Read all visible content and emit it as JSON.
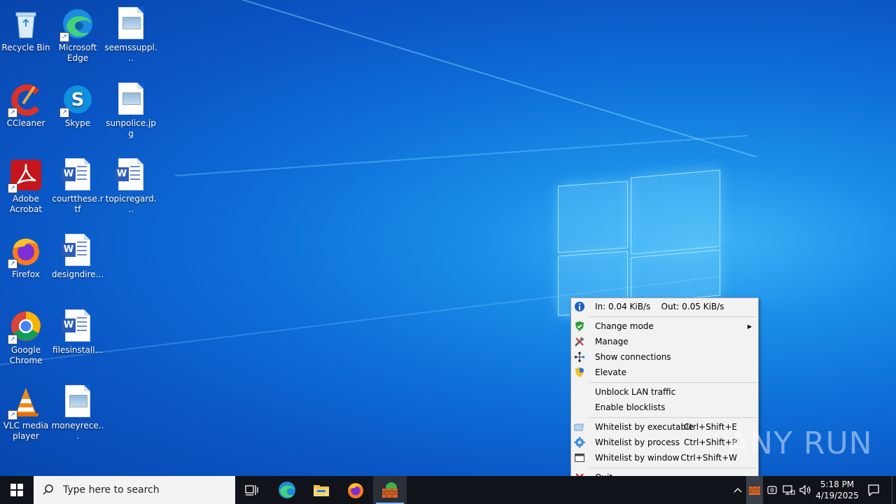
{
  "desktop": {
    "icons": [
      {
        "label": "Recycle Bin"
      },
      {
        "label": "Microsoft Edge"
      },
      {
        "label": "seemssuppl..."
      },
      {
        "label": "CCleaner"
      },
      {
        "label": "Skype"
      },
      {
        "label": "sunpolice.jpg"
      },
      {
        "label": "Adobe Acrobat"
      },
      {
        "label": "courtthese.rtf"
      },
      {
        "label": "topicregard..."
      },
      {
        "label": "Firefox"
      },
      {
        "label": "designdire..."
      },
      {
        "label": "Google Chrome"
      },
      {
        "label": "filesinstall..."
      },
      {
        "label": "VLC media player"
      },
      {
        "label": "moneyrece..."
      }
    ]
  },
  "menu": {
    "items": [
      {
        "label": "In: 0.04 KiB/s    Out: 0.05 KiB/s",
        "icon": "info-icon"
      },
      {
        "label": "Change mode",
        "icon": "shield-check-icon",
        "submenu": "▶"
      },
      {
        "label": "Manage",
        "icon": "tools-icon"
      },
      {
        "label": "Show connections",
        "icon": "network-icon"
      },
      {
        "label": "Elevate",
        "icon": "uac-shield-icon"
      },
      {
        "label": "Unblock LAN traffic"
      },
      {
        "label": "Enable blocklists"
      },
      {
        "label": "Whitelist by executable",
        "shortcut": "Ctrl+Shift+E",
        "icon": "executable-icon"
      },
      {
        "label": "Whitelist by process",
        "shortcut": "Ctrl+Shift+P",
        "icon": "gear-process-icon"
      },
      {
        "label": "Whitelist by window",
        "shortcut": "Ctrl+Shift+W",
        "icon": "window-icon"
      },
      {
        "label": "Quit",
        "icon": "close-x-icon"
      }
    ]
  },
  "taskbar": {
    "search_placeholder": "Type here to search",
    "time": "5:18 PM",
    "date": "4/19/2025"
  },
  "watermark": "ANY RUN",
  "colors": {
    "accent": "#0a6fd8",
    "taskbar": "#10131a"
  }
}
